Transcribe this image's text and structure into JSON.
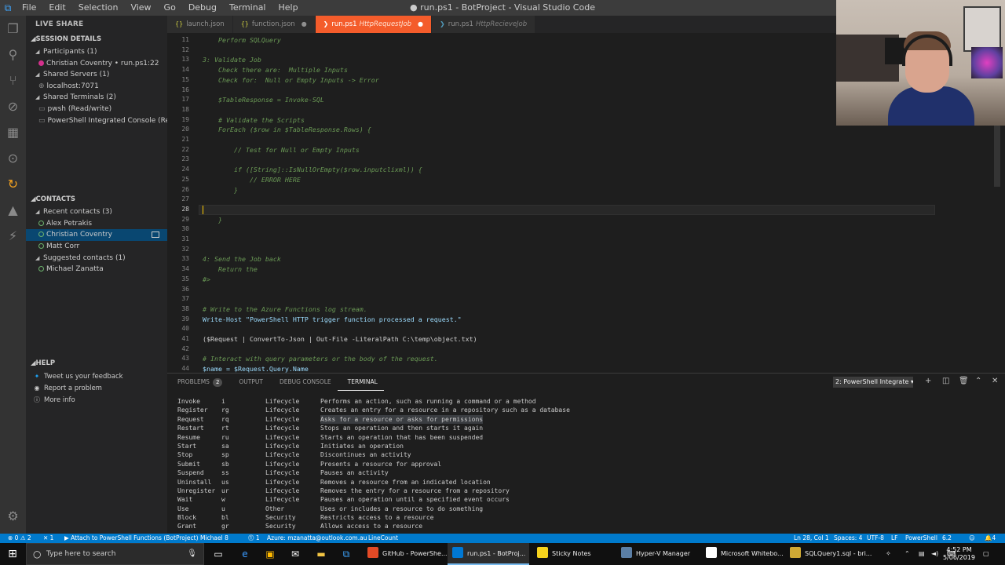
{
  "window": {
    "title": "● run.ps1 - BotProject - Visual Studio Code",
    "menu": [
      "File",
      "Edit",
      "Selection",
      "View",
      "Go",
      "Debug",
      "Terminal",
      "Help"
    ]
  },
  "sidebar": {
    "header": "LIVE SHARE",
    "session_section": "SESSION DETAILS",
    "session_items": [
      {
        "label": "Participants (1)",
        "level": 1,
        "twisty": "◢"
      },
      {
        "label": "Christian Coventry • run.ps1:22",
        "level": 2,
        "icon": "dot-fill"
      },
      {
        "label": "Shared Servers (1)",
        "level": 1,
        "twisty": "◢"
      },
      {
        "label": "localhost:7071",
        "level": 2,
        "icon": "server"
      },
      {
        "label": "Shared Terminals (2)",
        "level": 1,
        "twisty": "◢"
      },
      {
        "label": "pwsh (Read/write)",
        "level": 2,
        "icon": "terminal"
      },
      {
        "label": "PowerShell Integrated Console (Re...",
        "level": 2,
        "icon": "terminal"
      }
    ],
    "contacts_section": "CONTACTS",
    "contacts_items": [
      {
        "label": "Recent contacts (3)",
        "level": 1,
        "twisty": "◢"
      },
      {
        "label": "Alex Petrakis",
        "level": 2,
        "icon": "dot-open"
      },
      {
        "label": "Christian Coventry",
        "level": 2,
        "icon": "dot-open",
        "selected": true
      },
      {
        "label": "Matt Corr",
        "level": 2,
        "icon": "dot-open"
      },
      {
        "label": "Suggested contacts (1)",
        "level": 1,
        "twisty": "◢"
      },
      {
        "label": "Michael Zanatta",
        "level": 2,
        "icon": "dot-open"
      }
    ],
    "help_section": "HELP",
    "help_items": [
      {
        "label": "Tweet us your feedback",
        "icon": "twitter-icon"
      },
      {
        "label": "Report a problem",
        "icon": "report-icon"
      },
      {
        "label": "More info",
        "icon": "info-icon"
      }
    ]
  },
  "tabs": [
    {
      "label": "launch.json",
      "sub": "",
      "active": false,
      "modified": false
    },
    {
      "label": "function.json",
      "sub": "",
      "active": false,
      "modified": true
    },
    {
      "label": "run.ps1",
      "sub": "HttpRequestJob",
      "active": true,
      "modified": true
    },
    {
      "label": "run.ps1",
      "sub": "HttpRecieveJob",
      "active": false,
      "modified": false
    }
  ],
  "editor": {
    "lines": [
      {
        "n": "11",
        "text": "    Perform SQLQuery"
      },
      {
        "n": "12",
        "text": ""
      },
      {
        "n": "13",
        "text": "3: Validate Job"
      },
      {
        "n": "14",
        "text": "    Check there are:  Multiple Inputs"
      },
      {
        "n": "15",
        "text": "    Check for:  Null or Empty Inputs -> Error"
      },
      {
        "n": "16",
        "text": ""
      },
      {
        "n": "17",
        "text": "    $TableResponse = Invoke-SQL"
      },
      {
        "n": "18",
        "text": ""
      },
      {
        "n": "19",
        "text": "    # Validate the Scripts"
      },
      {
        "n": "20",
        "text": "    ForEach ($row in $TableResponse.Rows) {"
      },
      {
        "n": "21",
        "text": ""
      },
      {
        "n": "22",
        "text": "        // Test for Null or Empty Inputs"
      },
      {
        "n": "23",
        "text": ""
      },
      {
        "n": "24",
        "text": "        if ([String]::IsNullOrEmpty($row.inputclixml)) {"
      },
      {
        "n": "25",
        "text": "            // ERROR HERE"
      },
      {
        "n": "26",
        "text": "        }"
      },
      {
        "n": "27",
        "text": ""
      },
      {
        "n": "28",
        "text": ""
      },
      {
        "n": "29",
        "text": "    }"
      },
      {
        "n": "30",
        "text": ""
      },
      {
        "n": "31",
        "text": ""
      },
      {
        "n": "32",
        "text": ""
      },
      {
        "n": "33",
        "text": "4: Send the Job back"
      },
      {
        "n": "34",
        "text": "    Return the"
      },
      {
        "n": "35",
        "text": "#>"
      },
      {
        "n": "36",
        "text": ""
      },
      {
        "n": "37",
        "text": ""
      },
      {
        "n": "38",
        "text": "# Write to the Azure Functions log stream."
      },
      {
        "n": "39",
        "text": "Write-Host \"PowerShell HTTP trigger function processed a request.\""
      },
      {
        "n": "40",
        "text": ""
      },
      {
        "n": "41",
        "text": "($Request | ConvertTo-Json | Out-File -LiteralPath C:\\temp\\object.txt)"
      },
      {
        "n": "42",
        "text": ""
      },
      {
        "n": "43",
        "text": "# Interact with query parameters or the body of the request."
      },
      {
        "n": "44",
        "text": "$name = $Request.Query.Name"
      }
    ]
  },
  "panel": {
    "tabs": [
      {
        "label": "PROBLEMS",
        "badge": "2",
        "active": false
      },
      {
        "label": "OUTPUT",
        "badge": "",
        "active": false
      },
      {
        "label": "DEBUG CONSOLE",
        "badge": "",
        "active": false
      },
      {
        "label": "TERMINAL",
        "badge": "",
        "active": true
      }
    ],
    "terminal_select": "2: PowerShell Integrate ▾",
    "terminal_rows": [
      {
        "verb": "Invoke",
        "alias": "i",
        "group": "Lifecycle",
        "desc": "Performs an action, such as running a command or a method"
      },
      {
        "verb": "Register",
        "alias": "rg",
        "group": "Lifecycle",
        "desc": "Creates an entry for a resource in a repository such as a database"
      },
      {
        "verb": "Request",
        "alias": "rq",
        "group": "Lifecycle",
        "desc": "Asks for a resource or asks for permissions"
      },
      {
        "verb": "Restart",
        "alias": "rt",
        "group": "Lifecycle",
        "desc": "Stops an operation and then starts it again"
      },
      {
        "verb": "Resume",
        "alias": "ru",
        "group": "Lifecycle",
        "desc": "Starts an operation that has been suspended"
      },
      {
        "verb": "Start",
        "alias": "sa",
        "group": "Lifecycle",
        "desc": "Initiates an operation"
      },
      {
        "verb": "Stop",
        "alias": "sp",
        "group": "Lifecycle",
        "desc": "Discontinues an activity"
      },
      {
        "verb": "Submit",
        "alias": "sb",
        "group": "Lifecycle",
        "desc": "Presents a resource for approval"
      },
      {
        "verb": "Suspend",
        "alias": "ss",
        "group": "Lifecycle",
        "desc": "Pauses an activity"
      },
      {
        "verb": "Uninstall",
        "alias": "us",
        "group": "Lifecycle",
        "desc": "Removes a resource from an indicated location"
      },
      {
        "verb": "Unregister",
        "alias": "ur",
        "group": "Lifecycle",
        "desc": "Removes the entry for a resource from a repository"
      },
      {
        "verb": "Wait",
        "alias": "w",
        "group": "Lifecycle",
        "desc": "Pauses an operation until a specified event occurs"
      },
      {
        "verb": "Use",
        "alias": "u",
        "group": "Other",
        "desc": "Uses or includes a resource to do something"
      },
      {
        "verb": "Block",
        "alias": "bl",
        "group": "Security",
        "desc": "Restricts access to a resource"
      },
      {
        "verb": "Grant",
        "alias": "gr",
        "group": "Security",
        "desc": "Allows access to a resource"
      }
    ]
  },
  "statusbar": {
    "errors": "⊗ 0 ⚠ 2",
    "close_x": "✕ 1",
    "attach": "▶ Attach to PowerShell Functions (BotProject)",
    "user": "Michael 8",
    "live": "⓵ 1",
    "account": "Azure: mzanatta@outlook.com.au",
    "liveshare": "LineCount",
    "position": "Ln 28, Col 1",
    "spaces": "Spaces: 4",
    "encoding": "UTF-8",
    "eol": "LF",
    "language": "PowerShell",
    "version": "6.2",
    "bell": "4"
  },
  "taskbar": {
    "search_placeholder": "Type here to search",
    "apps": [
      {
        "label": "GitHub - PowerShe...",
        "color": "#e34a26",
        "active": false
      },
      {
        "label": "run.ps1 - BotProj...",
        "color": "#0078d4",
        "active": true
      },
      {
        "label": "Sticky Notes",
        "color": "#f6d31d",
        "active": false
      },
      {
        "label": "Hyper-V Manager",
        "color": "#5b7fa6",
        "active": false
      },
      {
        "label": "Microsoft Whitebo...",
        "color": "#ffffff",
        "active": false
      },
      {
        "label": "SQLQuery1.sql - bri...",
        "color": "#cfa935",
        "active": false
      }
    ],
    "time": "4:52 PM",
    "date": "5/06/2019"
  },
  "colors": {
    "accent": "#007acc",
    "active_tab": "#f45c2b",
    "editor_bg": "#1e1e1e"
  }
}
